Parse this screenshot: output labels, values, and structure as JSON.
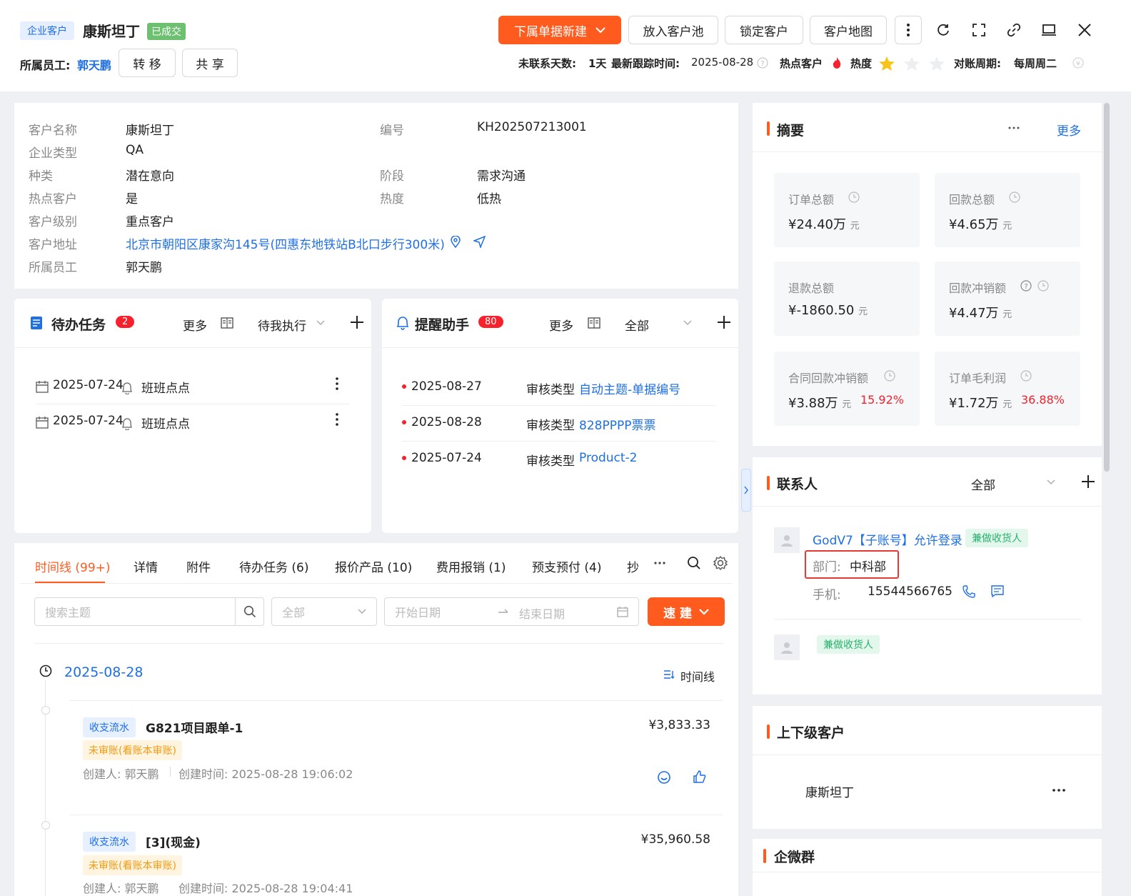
{
  "header": {
    "type_tag": "企业客户",
    "name": "康斯坦丁",
    "status_tag": "已成交",
    "owner_label": "所属员工:",
    "owner_name": "郭天鹏",
    "transfer": "转 移",
    "share": "共 享",
    "buttons": {
      "new_doc": "下属单据新建",
      "to_pool": "放入客户池",
      "lock": "锁定客户",
      "map": "客户地图"
    },
    "meta": {
      "no_contact_label": "未联系天数:",
      "no_contact_value": "1天",
      "last_follow_label": "最新跟踪时间:",
      "last_follow_value": "2025-08-28",
      "hot_label": "热点客户",
      "heat_label": "热度",
      "heat_stars": 1,
      "heat_max": 3,
      "cycle_label": "对账周期:",
      "cycle_value": "每周周二"
    }
  },
  "info": {
    "customer_name_label": "客户名称",
    "customer_name": "康斯坦丁",
    "code_label": "编号",
    "code": "KH202507213001",
    "ent_type_label": "企业类型",
    "ent_type": "QA",
    "kind_label": "种类",
    "kind": "潜在意向",
    "stage_label": "阶段",
    "stage": "需求沟通",
    "hot_label": "热点客户",
    "hot": "是",
    "heat_label": "热度",
    "heat": "低热",
    "level_label": "客户级别",
    "level": "重点客户",
    "address_label": "客户地址",
    "address": "北京市朝阳区康家沟145号(四惠东地铁站B北口步行300米)",
    "owner_label": "所属员工",
    "owner": "郭天鹏"
  },
  "todo": {
    "title": "待办任务",
    "count": "2",
    "more": "更多",
    "filter": "待我执行",
    "items": [
      {
        "date": "2025-07-24",
        "text": "班班点点"
      },
      {
        "date": "2025-07-24",
        "text": "班班点点"
      }
    ]
  },
  "reminder": {
    "title": "提醒助手",
    "count": "80",
    "more": "更多",
    "filter": "全部",
    "items": [
      {
        "date": "2025-08-27",
        "type": "审核类型",
        "link": "自动主题-单据编号"
      },
      {
        "date": "2025-08-28",
        "type": "审核类型",
        "link": "828PPPP票票"
      },
      {
        "date": "2025-07-24",
        "type": "审核类型",
        "link": "Product-2"
      }
    ]
  },
  "tabs": [
    "时间线 (99+)",
    "详情",
    "附件",
    "待办任务 (6)",
    "报价产品 (10)",
    "费用报销 (1)",
    "预支预付 (4)",
    "抄"
  ],
  "filters": {
    "search_placeholder": "搜索主题",
    "select_value": "全部",
    "start_placeholder": "开始日期",
    "end_placeholder": "结束日期",
    "quick_build": "速 建"
  },
  "timeline": {
    "date": "2025-08-28",
    "view_label": "时间线",
    "entries": [
      {
        "tag": "收支流水",
        "title": "G821项目跟单-1",
        "amount": "¥3,833.33",
        "status": "未审账(看账本审账)",
        "creator": "创建人: 郭天鹏",
        "created": "创建时间: 2025-08-28 19:06:02"
      },
      {
        "tag": "收支流水",
        "title": "[3](现金)",
        "amount": "¥35,960.58",
        "status": "未审账(看账本审账)",
        "creator": "创建人: 郭天鹏",
        "created": "创建时间: 2025-08-28 19:04:41"
      }
    ]
  },
  "summary": {
    "title": "摘要",
    "more": "更多",
    "stats": [
      {
        "label": "订单总额",
        "value": "¥24.40万",
        "unit": "元",
        "pct": ""
      },
      {
        "label": "回款总额",
        "value": "¥4.65万",
        "unit": "元",
        "pct": ""
      },
      {
        "label": "退款总额",
        "value": "¥-1860.50",
        "unit": "元",
        "pct": ""
      },
      {
        "label": "回款冲销额",
        "value": "¥4.47万",
        "unit": "元",
        "pct": ""
      },
      {
        "label": "合同回款冲销额",
        "value": "¥3.88万",
        "unit": "元",
        "pct": "15.92%"
      },
      {
        "label": "订单毛利润",
        "value": "¥1.72万",
        "unit": "元",
        "pct": "36.88%"
      }
    ]
  },
  "contacts": {
    "title": "联系人",
    "filter": "全部",
    "items": [
      {
        "name": "GodV7【子账号】允许登录",
        "tag": "兼做收货人",
        "dept_label": "部门:",
        "dept": "中科部",
        "phone_label": "手机:",
        "phone": "15544566765"
      },
      {
        "name": "",
        "tag": "兼做收货人"
      }
    ]
  },
  "related": {
    "title": "上下级客户",
    "item": "康斯坦丁"
  },
  "wechat": {
    "title": "企微群"
  },
  "colors": {
    "accent": "#ff5b1f",
    "link": "#1f6fe5",
    "danger": "#f5222d",
    "star": "#f7c51a"
  }
}
